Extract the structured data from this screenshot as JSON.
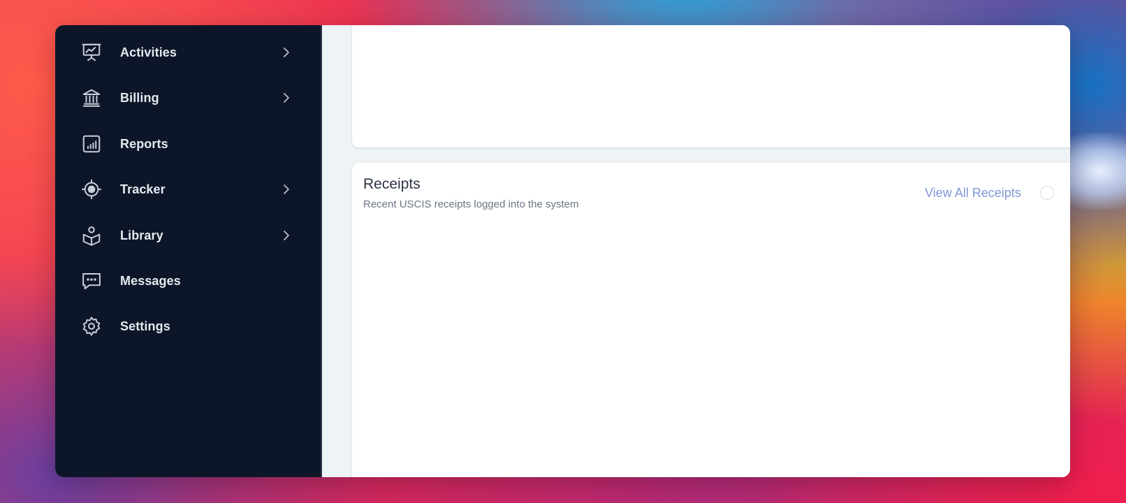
{
  "sidebar": {
    "items": [
      {
        "label": "Activities",
        "icon": "presentation-chart-icon",
        "has_submenu": true
      },
      {
        "label": "Billing",
        "icon": "bank-icon",
        "has_submenu": true
      },
      {
        "label": "Reports",
        "icon": "bar-chart-icon",
        "has_submenu": false
      },
      {
        "label": "Tracker",
        "icon": "crosshair-icon",
        "has_submenu": true
      },
      {
        "label": "Library",
        "icon": "book-reader-icon",
        "has_submenu": true
      },
      {
        "label": "Messages",
        "icon": "chat-bubble-icon",
        "has_submenu": false
      },
      {
        "label": "Settings",
        "icon": "gear-icon",
        "has_submenu": false
      }
    ]
  },
  "receipts": {
    "title": "Receipts",
    "subtitle": "Recent USCIS receipts logged into the system",
    "view_all_label": "View All Receipts"
  },
  "colors": {
    "sidebar_bg": "#0d1628",
    "content_bg": "#eef3f6",
    "card_bg": "#ffffff",
    "link": "#7f96d6"
  }
}
